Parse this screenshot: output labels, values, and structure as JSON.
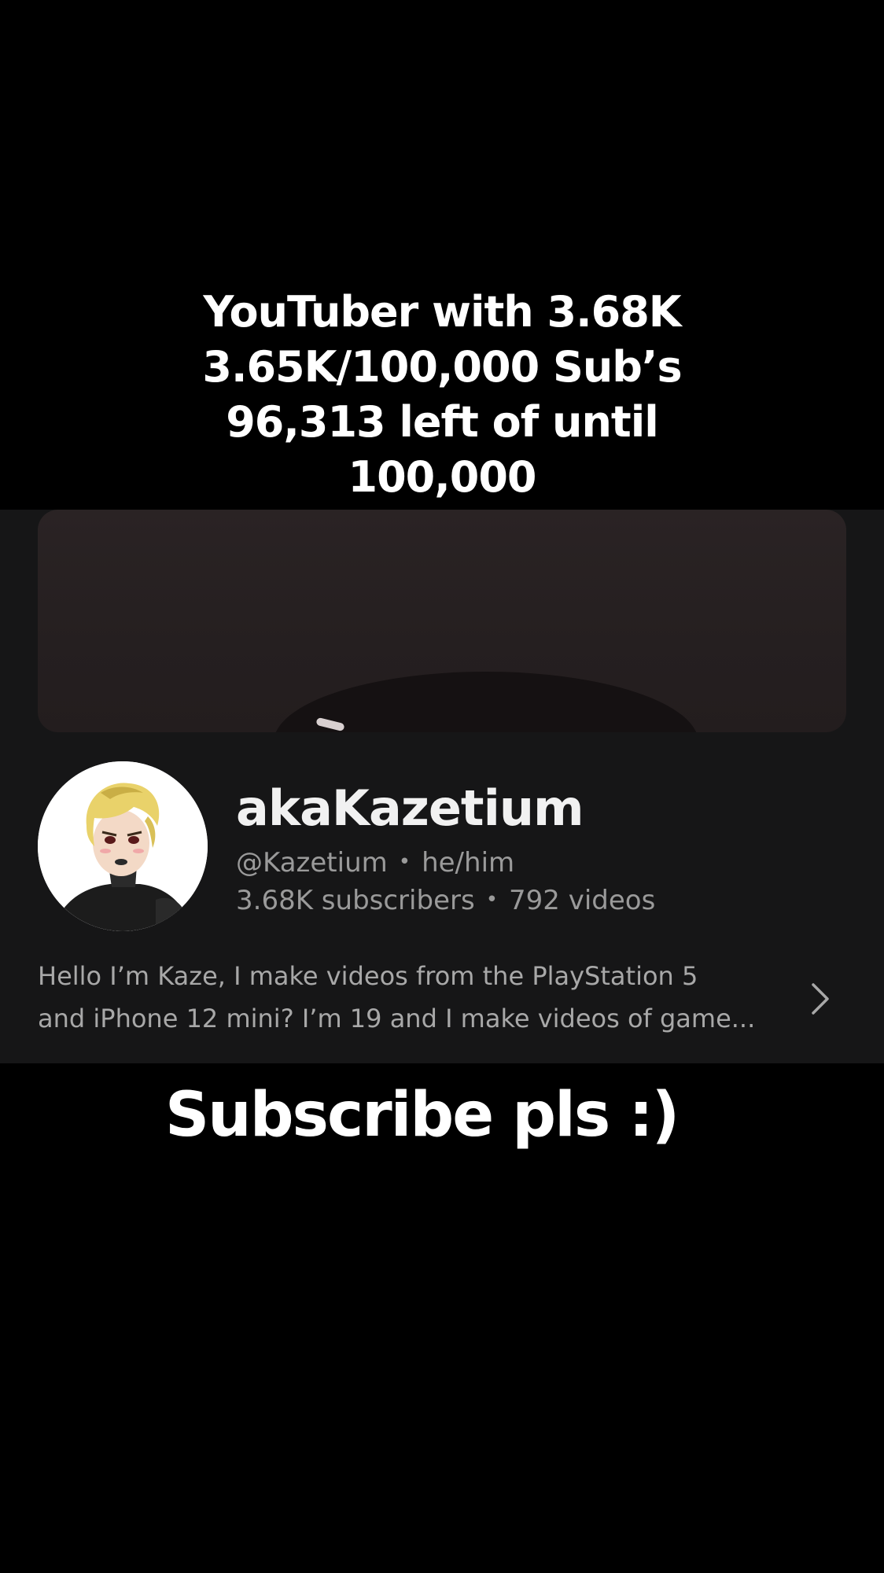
{
  "overlay_caption": {
    "lines": [
      "YouTuber with 3.68K",
      "3.65K/100,000 Sub’s",
      "96,313 left of until",
      "100,000"
    ]
  },
  "channel": {
    "name": "akaKazetium",
    "handle": "@Kazetium",
    "pronouns": "he/him",
    "separator": "•",
    "subscribers": "3.68K subscribers",
    "videos": "792 videos",
    "description_lines": [
      "Hello I’m Kaze, I make videos from the PlayStation 5",
      "and iPhone 12 mini? I’m 19 and I make videos of game..."
    ],
    "icons": {
      "avatar": "avatar-image",
      "more": "chevron-right-icon"
    }
  },
  "bottom_caption": {
    "text": "Subscribe pls :)"
  },
  "colors": {
    "background": "#000000",
    "panel": "#161617",
    "banner": "#2a2324",
    "primary_text": "#f1f1f1",
    "secondary_text": "#9a9a9a"
  }
}
